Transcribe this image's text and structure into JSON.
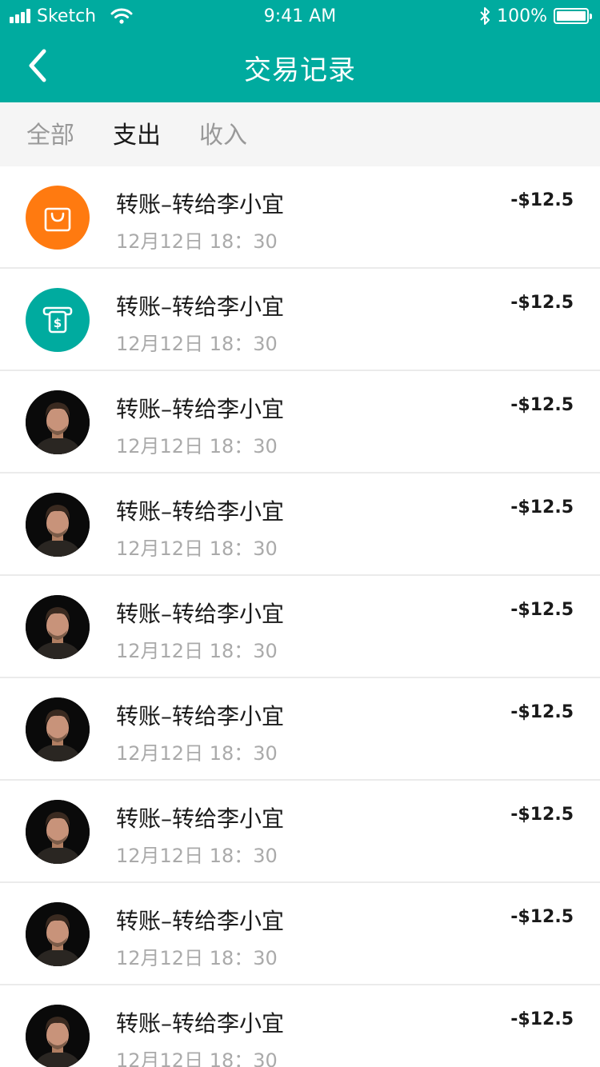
{
  "status_bar": {
    "carrier": "Sketch",
    "time": "9:41 AM",
    "battery": "100%",
    "signal_icon": "signal-bars-icon",
    "wifi_icon": "wifi-icon",
    "bluetooth_icon": "bluetooth-icon",
    "battery_icon": "battery-icon"
  },
  "nav": {
    "title": "交易记录",
    "back_icon": "chevron-left-icon"
  },
  "tabs": [
    {
      "label": "全部",
      "active": false
    },
    {
      "label": "支出",
      "active": true
    },
    {
      "label": "收入",
      "active": false
    }
  ],
  "transactions": [
    {
      "icon": "shopping-bag-icon",
      "title": "转账–转给李小宜",
      "time": "12月12日 18：30",
      "amount": "-$12.5"
    },
    {
      "icon": "atm-dollar-icon",
      "title": "转账–转给李小宜",
      "time": "12月12日 18：30",
      "amount": "-$12.5"
    },
    {
      "icon": "user-avatar",
      "title": "转账–转给李小宜",
      "time": "12月12日 18：30",
      "amount": "-$12.5"
    },
    {
      "icon": "user-avatar",
      "title": "转账–转给李小宜",
      "time": "12月12日 18：30",
      "amount": "-$12.5"
    },
    {
      "icon": "user-avatar",
      "title": "转账–转给李小宜",
      "time": "12月12日 18：30",
      "amount": "-$12.5"
    },
    {
      "icon": "user-avatar",
      "title": "转账–转给李小宜",
      "time": "12月12日 18：30",
      "amount": "-$12.5"
    },
    {
      "icon": "user-avatar",
      "title": "转账–转给李小宜",
      "time": "12月12日 18：30",
      "amount": "-$12.5"
    },
    {
      "icon": "user-avatar",
      "title": "转账–转给李小宜",
      "time": "12月12日 18：30",
      "amount": "-$12.5"
    },
    {
      "icon": "user-avatar",
      "title": "转账–转给李小宜",
      "time": "12月12日 18：30",
      "amount": "-$12.5"
    }
  ],
  "colors": {
    "header": "#00ab9f",
    "shopping_icon_bg": "#ff7a10",
    "atm_icon_bg": "#00ab9f",
    "tab_bar_bg": "#f5f5f5",
    "text_primary": "#1a1a1a",
    "text_secondary": "#aaaaaa"
  }
}
